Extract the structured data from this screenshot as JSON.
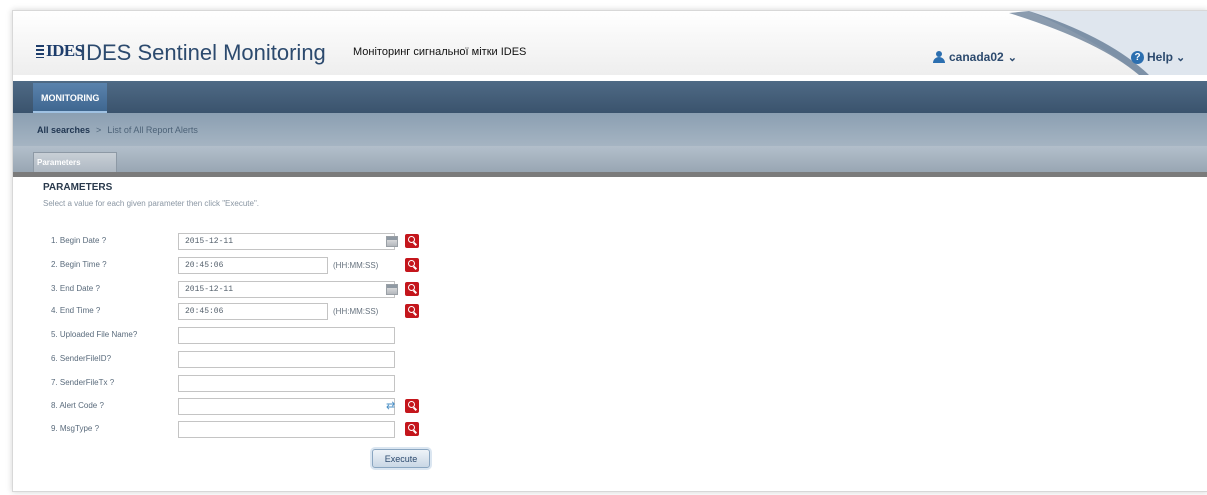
{
  "header": {
    "logo_text": "IDES",
    "app_title": "IDES Sentinel Monitoring",
    "translation": "Моніторинг сигнальної мітки IDES",
    "user": "canada02",
    "help": "Help"
  },
  "nav": {
    "tabs": [
      {
        "label": "MONITORING"
      }
    ]
  },
  "breadcrumb": {
    "root": "All searches",
    "separator": ">",
    "current": "List of All Report Alerts"
  },
  "tabstrip": {
    "active_tab": "Parameters"
  },
  "parameters": {
    "title": "PARAMETERS",
    "description": "Select a value for each given parameter then click \"Execute\".",
    "fields": [
      {
        "label": "1. Begin Date ?",
        "value": "2015-12-11",
        "format": "",
        "icon": "calendar-icon"
      },
      {
        "label": "2. Begin Time ?",
        "value": "20:45:06",
        "format": "(HH:MM:SS)",
        "icon": ""
      },
      {
        "label": "3. End Date ?",
        "value": "2015-12-11",
        "format": "",
        "icon": "calendar-icon"
      },
      {
        "label": "4. End Time ?",
        "value": "20:45:06",
        "format": "(HH:MM:SS)",
        "icon": ""
      },
      {
        "label": "5. Uploaded File Name?",
        "value": "",
        "format": "",
        "icon": ""
      },
      {
        "label": "6. SenderFileID?",
        "value": "",
        "format": "",
        "icon": ""
      },
      {
        "label": "7. SenderFileTx ?",
        "value": "",
        "format": "",
        "icon": ""
      },
      {
        "label": "8. Alert Code ?",
        "value": "",
        "format": "",
        "icon": "list-icon"
      },
      {
        "label": "9. MsgType ?",
        "value": "",
        "format": "",
        "icon": ""
      }
    ],
    "execute_label": "Execute"
  },
  "colors": {
    "navbar": "#3a536d",
    "nav_tab": "#4f78a3",
    "search_button": "#c4161c",
    "title_text": "#2c4a6e"
  }
}
